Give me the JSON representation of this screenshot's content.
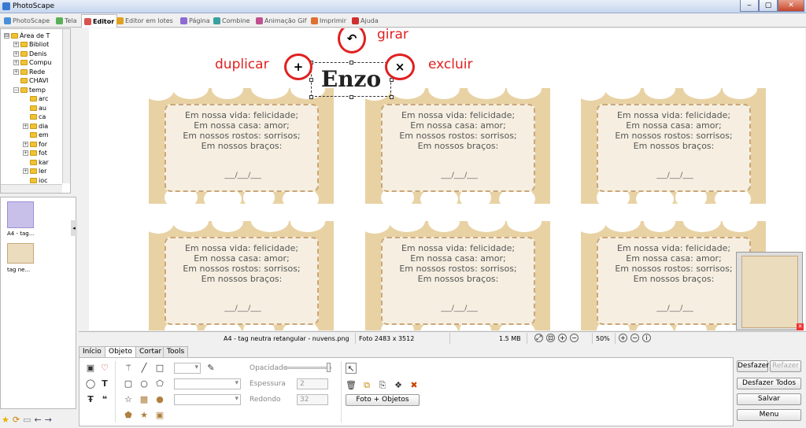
{
  "window": {
    "title": "PhotoScape",
    "min": "‒",
    "max": "▢",
    "close": "✕"
  },
  "tabs": [
    {
      "label": "PhotoScape",
      "color": "#4a90d9"
    },
    {
      "label": "Tela",
      "color": "#5ab05a"
    },
    {
      "label": "Editor",
      "color": "#d9534f"
    },
    {
      "label": "Editor em lotes",
      "color": "#e0a020"
    },
    {
      "label": "Página",
      "color": "#8e6bd1"
    },
    {
      "label": "Combine",
      "color": "#3aa0a0"
    },
    {
      "label": "Animação Gif",
      "color": "#c05090"
    },
    {
      "label": "Imprimir",
      "color": "#e07030"
    },
    {
      "label": "Ajuda",
      "color": "#d03030"
    }
  ],
  "tree": [
    {
      "label": "Área de T",
      "level": 0,
      "pm": "⊟"
    },
    {
      "label": "Bibliot",
      "level": 1,
      "pm": "+"
    },
    {
      "label": "Denis",
      "level": 1,
      "pm": "+"
    },
    {
      "label": "Compu",
      "level": 1,
      "pm": "+"
    },
    {
      "label": "Rede",
      "level": 1,
      "pm": "+"
    },
    {
      "label": "CHAVI",
      "level": 1,
      "pm": ""
    },
    {
      "label": "temp",
      "level": 1,
      "pm": "−"
    },
    {
      "label": "arc",
      "level": 2,
      "pm": ""
    },
    {
      "label": "au",
      "level": 2,
      "pm": ""
    },
    {
      "label": "ca",
      "level": 2,
      "pm": ""
    },
    {
      "label": "dia",
      "level": 2,
      "pm": "+"
    },
    {
      "label": "em",
      "level": 2,
      "pm": ""
    },
    {
      "label": "for",
      "level": 2,
      "pm": "+"
    },
    {
      "label": "fot",
      "level": 2,
      "pm": "+"
    },
    {
      "label": "kar",
      "level": 2,
      "pm": ""
    },
    {
      "label": "ler",
      "level": 2,
      "pm": "+"
    },
    {
      "label": "ioc",
      "level": 2,
      "pm": ""
    }
  ],
  "thumbnails": [
    {
      "caption": "A4 - tag..."
    },
    {
      "caption": "tag ne..."
    }
  ],
  "card": {
    "lines": [
      "Em nossa vida: felicidade;",
      "Em nossa casa: amor;",
      "Em nossos rostos: sorrisos;",
      "Em nossos braços:"
    ],
    "date": "___/___/___"
  },
  "overlay": {
    "name_text": "Enzo",
    "girar": "girar",
    "duplicar": "duplicar",
    "excluir": "excluir",
    "plus": "+",
    "times": "×",
    "rotate": "↶"
  },
  "status": {
    "filename": "A4 - tag neutra retangular - nuvens.png",
    "photo_size": "Foto 2483 x 3512",
    "file_size": "1.5 MB",
    "zoom": "50%"
  },
  "bottom_tabs": [
    "Início",
    "Objeto",
    "Cortar",
    "Tools"
  ],
  "panel": {
    "opacity_label": "Opacidade",
    "thickness_label": "Espessura",
    "thickness_value": "2",
    "rounded_label": "Redondo",
    "rounded_value": "32",
    "photo_objects_btn": "Foto + Objetos"
  },
  "actions": {
    "undo": "Desfazer",
    "redo": "Refazer",
    "undo_all": "Desfazer Todos",
    "save": "Salvar",
    "menu": "Menu"
  },
  "colors": {
    "accent_red": "#e02020",
    "card_tan": "#e8d2a4"
  }
}
